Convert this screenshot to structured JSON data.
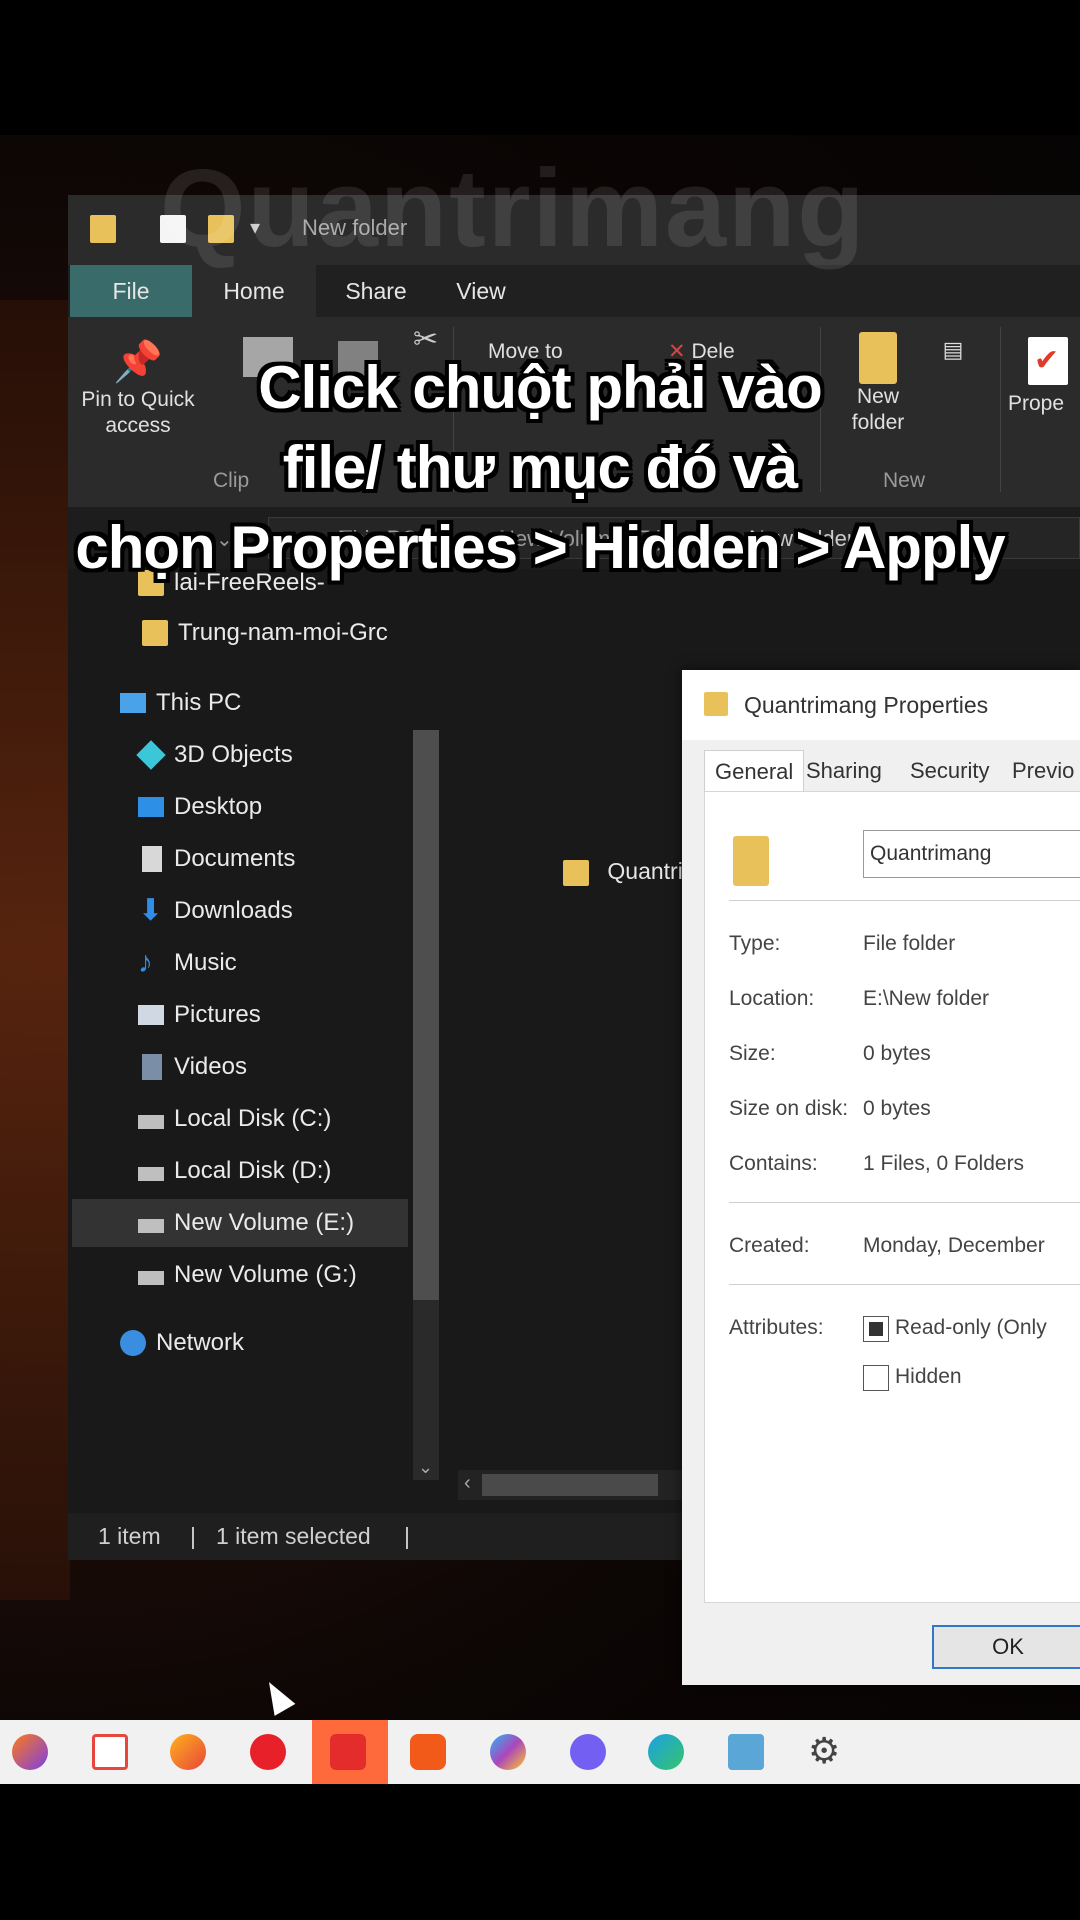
{
  "watermark": "Quantrimang",
  "caption": {
    "line1": "Click chuột phải vào",
    "line2": "file/ thư mục đó và",
    "line3": "chọn Properties > Hidden > Apply"
  },
  "explorer": {
    "title": "New folder",
    "menu": {
      "file": "File",
      "home": "Home",
      "share": "Share",
      "view": "View"
    },
    "ribbon": {
      "pin_line1": "Pin to Quick",
      "pin_line2": "access",
      "clipboard_group": "Clip",
      "move_to": "Move to",
      "delete": "Dele",
      "new_folder_line1": "New",
      "new_folder_line2": "folder",
      "new_group": "New",
      "properties": "Prope"
    },
    "address": {
      "path_part1": "This PC",
      "path_part2": "New Volume (E:)",
      "path_part3": "New folder"
    },
    "nav": {
      "recent_1": "lai-FreeReels-",
      "recent_2": "Trung-nam-moi-Grc",
      "this_pc": "This PC",
      "objects_3d": "3D Objects",
      "desktop": "Desktop",
      "documents": "Documents",
      "downloads": "Downloads",
      "music": "Music",
      "pictures": "Pictures",
      "videos": "Videos",
      "local_c": "Local Disk (C:)",
      "local_d": "Local Disk (D:)",
      "volume_e": "New Volume (E:)",
      "volume_g": "New Volume (G:)",
      "network": "Network"
    },
    "content": {
      "item": "Quantrimang"
    },
    "status": {
      "count": "1 item",
      "selected": "1 item selected",
      "sep": "|"
    }
  },
  "properties_dialog": {
    "title": "Quantrimang Properties",
    "tabs": [
      "General",
      "Sharing",
      "Security",
      "Previo"
    ],
    "name_value": "Quantrimang",
    "type_label": "Type:",
    "type_value": "File folder",
    "location_label": "Location:",
    "location_value": "E:\\New folder",
    "size_label": "Size:",
    "size_value": "0 bytes",
    "size_on_disk_label": "Size on disk:",
    "size_on_disk_value": "0 bytes",
    "contains_label": "Contains:",
    "contains_value": "1 Files, 0 Folders",
    "created_label": "Created:",
    "created_value": "Monday, December",
    "attributes_label": "Attributes:",
    "readonly_label": "Read-only (Only",
    "hidden_label": "Hidden",
    "ok_label": "OK"
  },
  "taskbar": {
    "icons": [
      "firefox-icon",
      "app-icon",
      "firefox-icon",
      "record-icon",
      "wps-icon",
      "brave-icon",
      "app-icon",
      "viber-icon",
      "edge-icon",
      "photos-icon",
      "settings-icon"
    ]
  }
}
